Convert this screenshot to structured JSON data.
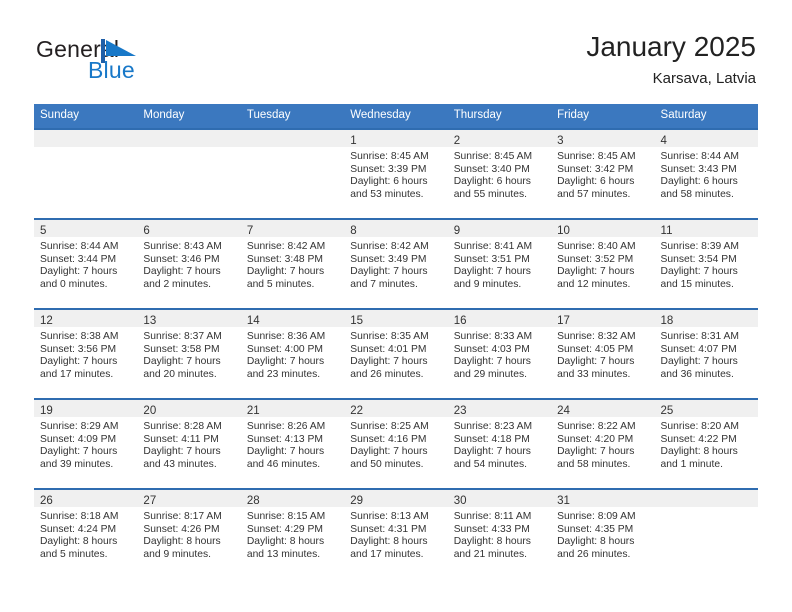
{
  "brand": {
    "name_part1": "General",
    "name_part2": "Blue",
    "mark_icon": "blue-triangle-flag-icon",
    "color_dark": "#231f20",
    "color_blue": "#1878c8"
  },
  "header": {
    "title": "January 2025",
    "subtitle": "Karsava, Latvia"
  },
  "theme": {
    "header_blue": "#3b78bf",
    "row_rule_blue": "#2f6cb0",
    "daynum_band": "#f0f0f0",
    "text": "#333333"
  },
  "calendar": {
    "weekday_headers": [
      "Sunday",
      "Monday",
      "Tuesday",
      "Wednesday",
      "Thursday",
      "Friday",
      "Saturday"
    ],
    "weeks": [
      [
        {
          "day": "",
          "sunrise": "",
          "sunset": "",
          "daylight_line1": "",
          "daylight_line2": ""
        },
        {
          "day": "",
          "sunrise": "",
          "sunset": "",
          "daylight_line1": "",
          "daylight_line2": ""
        },
        {
          "day": "",
          "sunrise": "",
          "sunset": "",
          "daylight_line1": "",
          "daylight_line2": ""
        },
        {
          "day": "1",
          "sunrise": "Sunrise: 8:45 AM",
          "sunset": "Sunset: 3:39 PM",
          "daylight_line1": "Daylight: 6 hours",
          "daylight_line2": "and 53 minutes."
        },
        {
          "day": "2",
          "sunrise": "Sunrise: 8:45 AM",
          "sunset": "Sunset: 3:40 PM",
          "daylight_line1": "Daylight: 6 hours",
          "daylight_line2": "and 55 minutes."
        },
        {
          "day": "3",
          "sunrise": "Sunrise: 8:45 AM",
          "sunset": "Sunset: 3:42 PM",
          "daylight_line1": "Daylight: 6 hours",
          "daylight_line2": "and 57 minutes."
        },
        {
          "day": "4",
          "sunrise": "Sunrise: 8:44 AM",
          "sunset": "Sunset: 3:43 PM",
          "daylight_line1": "Daylight: 6 hours",
          "daylight_line2": "and 58 minutes."
        }
      ],
      [
        {
          "day": "5",
          "sunrise": "Sunrise: 8:44 AM",
          "sunset": "Sunset: 3:44 PM",
          "daylight_line1": "Daylight: 7 hours",
          "daylight_line2": "and 0 minutes."
        },
        {
          "day": "6",
          "sunrise": "Sunrise: 8:43 AM",
          "sunset": "Sunset: 3:46 PM",
          "daylight_line1": "Daylight: 7 hours",
          "daylight_line2": "and 2 minutes."
        },
        {
          "day": "7",
          "sunrise": "Sunrise: 8:42 AM",
          "sunset": "Sunset: 3:48 PM",
          "daylight_line1": "Daylight: 7 hours",
          "daylight_line2": "and 5 minutes."
        },
        {
          "day": "8",
          "sunrise": "Sunrise: 8:42 AM",
          "sunset": "Sunset: 3:49 PM",
          "daylight_line1": "Daylight: 7 hours",
          "daylight_line2": "and 7 minutes."
        },
        {
          "day": "9",
          "sunrise": "Sunrise: 8:41 AM",
          "sunset": "Sunset: 3:51 PM",
          "daylight_line1": "Daylight: 7 hours",
          "daylight_line2": "and 9 minutes."
        },
        {
          "day": "10",
          "sunrise": "Sunrise: 8:40 AM",
          "sunset": "Sunset: 3:52 PM",
          "daylight_line1": "Daylight: 7 hours",
          "daylight_line2": "and 12 minutes."
        },
        {
          "day": "11",
          "sunrise": "Sunrise: 8:39 AM",
          "sunset": "Sunset: 3:54 PM",
          "daylight_line1": "Daylight: 7 hours",
          "daylight_line2": "and 15 minutes."
        }
      ],
      [
        {
          "day": "12",
          "sunrise": "Sunrise: 8:38 AM",
          "sunset": "Sunset: 3:56 PM",
          "daylight_line1": "Daylight: 7 hours",
          "daylight_line2": "and 17 minutes."
        },
        {
          "day": "13",
          "sunrise": "Sunrise: 8:37 AM",
          "sunset": "Sunset: 3:58 PM",
          "daylight_line1": "Daylight: 7 hours",
          "daylight_line2": "and 20 minutes."
        },
        {
          "day": "14",
          "sunrise": "Sunrise: 8:36 AM",
          "sunset": "Sunset: 4:00 PM",
          "daylight_line1": "Daylight: 7 hours",
          "daylight_line2": "and 23 minutes."
        },
        {
          "day": "15",
          "sunrise": "Sunrise: 8:35 AM",
          "sunset": "Sunset: 4:01 PM",
          "daylight_line1": "Daylight: 7 hours",
          "daylight_line2": "and 26 minutes."
        },
        {
          "day": "16",
          "sunrise": "Sunrise: 8:33 AM",
          "sunset": "Sunset: 4:03 PM",
          "daylight_line1": "Daylight: 7 hours",
          "daylight_line2": "and 29 minutes."
        },
        {
          "day": "17",
          "sunrise": "Sunrise: 8:32 AM",
          "sunset": "Sunset: 4:05 PM",
          "daylight_line1": "Daylight: 7 hours",
          "daylight_line2": "and 33 minutes."
        },
        {
          "day": "18",
          "sunrise": "Sunrise: 8:31 AM",
          "sunset": "Sunset: 4:07 PM",
          "daylight_line1": "Daylight: 7 hours",
          "daylight_line2": "and 36 minutes."
        }
      ],
      [
        {
          "day": "19",
          "sunrise": "Sunrise: 8:29 AM",
          "sunset": "Sunset: 4:09 PM",
          "daylight_line1": "Daylight: 7 hours",
          "daylight_line2": "and 39 minutes."
        },
        {
          "day": "20",
          "sunrise": "Sunrise: 8:28 AM",
          "sunset": "Sunset: 4:11 PM",
          "daylight_line1": "Daylight: 7 hours",
          "daylight_line2": "and 43 minutes."
        },
        {
          "day": "21",
          "sunrise": "Sunrise: 8:26 AM",
          "sunset": "Sunset: 4:13 PM",
          "daylight_line1": "Daylight: 7 hours",
          "daylight_line2": "and 46 minutes."
        },
        {
          "day": "22",
          "sunrise": "Sunrise: 8:25 AM",
          "sunset": "Sunset: 4:16 PM",
          "daylight_line1": "Daylight: 7 hours",
          "daylight_line2": "and 50 minutes."
        },
        {
          "day": "23",
          "sunrise": "Sunrise: 8:23 AM",
          "sunset": "Sunset: 4:18 PM",
          "daylight_line1": "Daylight: 7 hours",
          "daylight_line2": "and 54 minutes."
        },
        {
          "day": "24",
          "sunrise": "Sunrise: 8:22 AM",
          "sunset": "Sunset: 4:20 PM",
          "daylight_line1": "Daylight: 7 hours",
          "daylight_line2": "and 58 minutes."
        },
        {
          "day": "25",
          "sunrise": "Sunrise: 8:20 AM",
          "sunset": "Sunset: 4:22 PM",
          "daylight_line1": "Daylight: 8 hours",
          "daylight_line2": "and 1 minute."
        }
      ],
      [
        {
          "day": "26",
          "sunrise": "Sunrise: 8:18 AM",
          "sunset": "Sunset: 4:24 PM",
          "daylight_line1": "Daylight: 8 hours",
          "daylight_line2": "and 5 minutes."
        },
        {
          "day": "27",
          "sunrise": "Sunrise: 8:17 AM",
          "sunset": "Sunset: 4:26 PM",
          "daylight_line1": "Daylight: 8 hours",
          "daylight_line2": "and 9 minutes."
        },
        {
          "day": "28",
          "sunrise": "Sunrise: 8:15 AM",
          "sunset": "Sunset: 4:29 PM",
          "daylight_line1": "Daylight: 8 hours",
          "daylight_line2": "and 13 minutes."
        },
        {
          "day": "29",
          "sunrise": "Sunrise: 8:13 AM",
          "sunset": "Sunset: 4:31 PM",
          "daylight_line1": "Daylight: 8 hours",
          "daylight_line2": "and 17 minutes."
        },
        {
          "day": "30",
          "sunrise": "Sunrise: 8:11 AM",
          "sunset": "Sunset: 4:33 PM",
          "daylight_line1": "Daylight: 8 hours",
          "daylight_line2": "and 21 minutes."
        },
        {
          "day": "31",
          "sunrise": "Sunrise: 8:09 AM",
          "sunset": "Sunset: 4:35 PM",
          "daylight_line1": "Daylight: 8 hours",
          "daylight_line2": "and 26 minutes."
        },
        {
          "day": "",
          "sunrise": "",
          "sunset": "",
          "daylight_line1": "",
          "daylight_line2": ""
        }
      ]
    ]
  }
}
